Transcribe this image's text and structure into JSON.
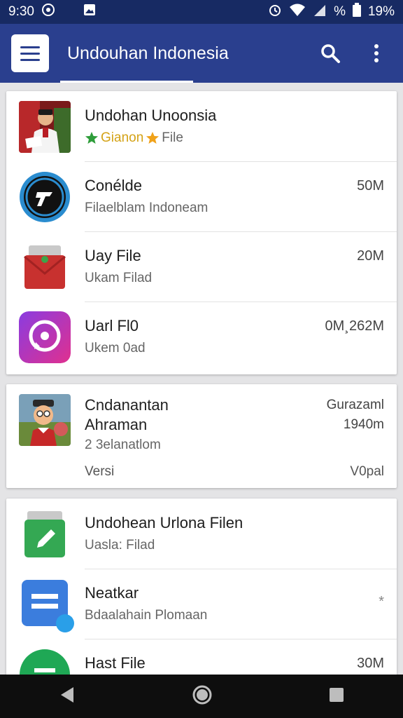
{
  "status_bar": {
    "time": "9:30",
    "battery": "19%",
    "signal_percent": "%",
    "icons": [
      "whatsapp-icon",
      "photo-icon",
      "alarm-icon",
      "wifi-icon",
      "signal-icon",
      "battery-icon"
    ]
  },
  "app_bar": {
    "title": "Undouhan Indonesia",
    "actions": [
      "search-icon",
      "more-vert-icon"
    ],
    "colors": {
      "bar": "#2a3f8e",
      "status": "#172a63"
    }
  },
  "card1": {
    "items": [
      {
        "title": "Undohan Unoonsia",
        "sub_left": "Gianon",
        "sub_right": "File",
        "size": ""
      },
      {
        "title": "Conélde",
        "sub": "Filaelblam Indoneam",
        "size": "50M"
      },
      {
        "title": "Uay File",
        "sub": "Ukam Filad",
        "size": "20M"
      },
      {
        "title": "Uarl Fl0",
        "sub": "Ukem 0ad",
        "size": "0M¸262M"
      }
    ]
  },
  "card2": {
    "title_line1": "Cndanantan",
    "title_line2": "Ahraman",
    "sub": "2 3elanatlom",
    "version_label": "Versi",
    "right_line1": "Gurazaml",
    "right_line2": "1940m",
    "version_value": "V0pal"
  },
  "card3": {
    "items": [
      {
        "title": "Undohean Urlona Filen",
        "sub": "Uasla: Filad",
        "size": ""
      },
      {
        "title": "Neatkar",
        "sub": "Bdaalahain Plomaan",
        "size": "*"
      },
      {
        "title": "Hast File",
        "sub": "",
        "size": "30M"
      }
    ]
  },
  "nav_bar": {
    "buttons": [
      "back-icon",
      "home-icon",
      "recents-icon"
    ]
  }
}
